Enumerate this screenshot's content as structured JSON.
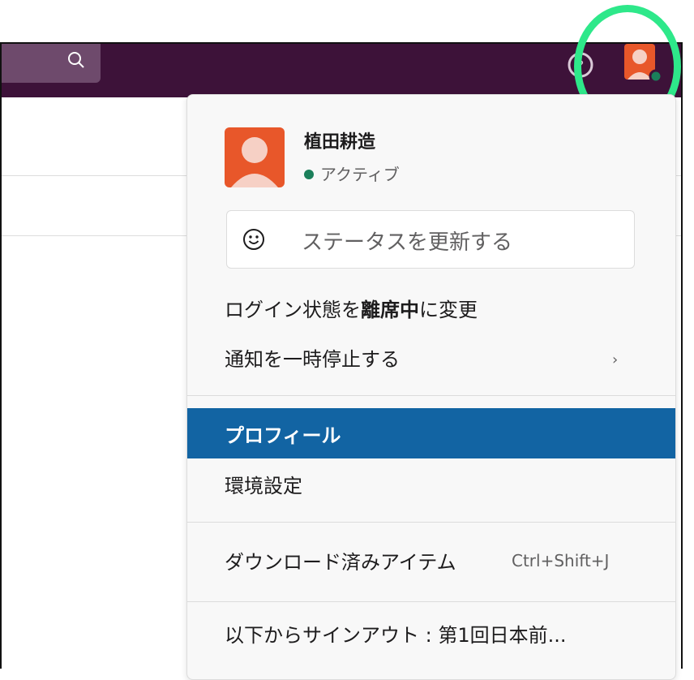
{
  "topbar": {
    "search_icon": "search-icon",
    "help_icon": "help-icon"
  },
  "menu": {
    "user": {
      "name": "植田耕造",
      "status": "アクティブ",
      "status_color": "#1b7f5a"
    },
    "status_input": {
      "placeholder": "ステータスを更新する"
    },
    "items": {
      "away_prefix": "ログイン状態を",
      "away_bold": "離席中",
      "away_suffix": "に変更",
      "pause": "通知を一時停止する",
      "pause_chevron": "›",
      "profile": "プロフィール",
      "preferences": "環境設定",
      "downloads": "ダウンロード済みアイテム",
      "downloads_shortcut": "Ctrl+Shift+J",
      "signout": "以下からサインアウト : 第1回日本前..."
    }
  },
  "colors": {
    "topbar": "#3d1239",
    "highlight": "#1264a3",
    "annotation_circle": "#2ee88a",
    "avatar": "#e8572a"
  }
}
